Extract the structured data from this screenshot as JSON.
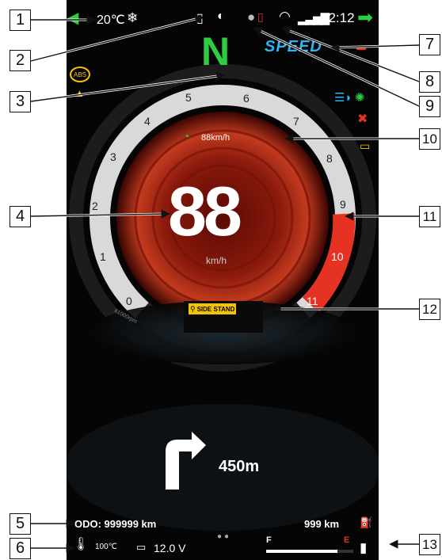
{
  "status_bar": {
    "temperature": "20℃",
    "time": "12:12"
  },
  "gear": "N",
  "drive_mode": "SPEED",
  "rpm_ticks": [
    "0",
    "1",
    "2",
    "3",
    "4",
    "5",
    "6",
    "7",
    "8",
    "9",
    "10",
    "11"
  ],
  "rpm_unit_label": "X1000rpm",
  "cruise_speed": "88km/h",
  "speed": {
    "value": "88",
    "unit": "km/h"
  },
  "side_stand_warning": "SIDE STAND",
  "navigation": {
    "distance": "450m"
  },
  "bottom": {
    "odo": "ODO: 999999 km",
    "range": "999 km",
    "coolant_temp": "100℃",
    "battery_voltage": "12.0 V",
    "fuel_full_label": "F",
    "fuel_empty_label": "E",
    "fuel_level": 0.82
  },
  "callouts": [
    "1",
    "2",
    "3",
    "4",
    "5",
    "6",
    "7",
    "8",
    "9",
    "10",
    "11",
    "12",
    "13"
  ],
  "colors": {
    "accent_green": "#2ecc40",
    "redline": "#e53222",
    "warning_yellow": "#f5c400",
    "mode_blue": "#29b6f6"
  }
}
